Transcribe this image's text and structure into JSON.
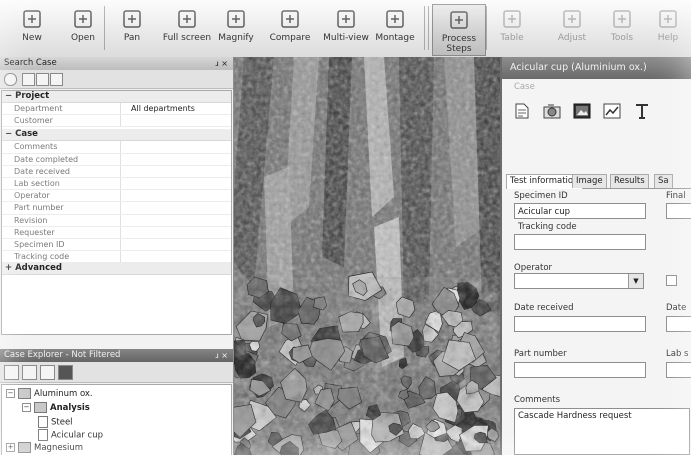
{
  "toolbar": {
    "buttons": [
      {
        "label": "New",
        "icon": "new-document-icon"
      },
      {
        "label": "Open",
        "icon": "open-folder-icon"
      },
      {
        "label": "Pan",
        "icon": "pan-hand-icon"
      },
      {
        "label": "Full screen",
        "icon": "full-screen-icon"
      },
      {
        "label": "Magnify",
        "icon": "magnifier-icon"
      },
      {
        "label": "Compare",
        "icon": "compare-icon"
      },
      {
        "label": "Multi-view",
        "icon": "multi-view-icon"
      },
      {
        "label": "Montage",
        "icon": "montage-icon"
      },
      {
        "label": "Process Steps",
        "icon": "process-steps-icon"
      },
      {
        "label": "Table",
        "icon": "table-icon"
      },
      {
        "label": "Adjust",
        "icon": "adjust-icon"
      },
      {
        "label": "Tools",
        "icon": "tools-icon"
      },
      {
        "label": "Help",
        "icon": "help-icon"
      }
    ]
  },
  "search_case": {
    "title": "Search Case",
    "pin": "ɹ ×",
    "project_section": "Project",
    "project_rows": [
      {
        "key": "Department",
        "value": "All departments"
      },
      {
        "key": "Customer",
        "value": ""
      }
    ],
    "case_section": "Case",
    "case_rows": [
      {
        "key": "Comments",
        "value": ""
      },
      {
        "key": "Date completed",
        "value": ""
      },
      {
        "key": "Date received",
        "value": ""
      },
      {
        "key": "Lab section",
        "value": ""
      },
      {
        "key": "Operator",
        "value": ""
      },
      {
        "key": "Part number",
        "value": ""
      },
      {
        "key": "Revision",
        "value": ""
      },
      {
        "key": "Requester",
        "value": ""
      },
      {
        "key": "Specimen ID",
        "value": ""
      },
      {
        "key": "Tracking code",
        "value": ""
      }
    ],
    "advanced_section": "Advanced"
  },
  "case_explorer": {
    "title": "Case Explorer - Not Filtered",
    "pin": "ɹ ×",
    "tree": [
      {
        "label": "Aluminum ox.",
        "level": 0
      },
      {
        "label": "Analysis",
        "level": 1
      },
      {
        "label": "Steel",
        "level": 2
      },
      {
        "label": "Acicular cup",
        "level": 2
      },
      {
        "label": "Magnesium",
        "level": 0
      }
    ]
  },
  "dialog": {
    "title": "Acicular cup (Aluminium ox.)",
    "menu": "Case",
    "tabs": [
      "Test information",
      "Image",
      "Results",
      "Sa"
    ],
    "fields": {
      "specimen_id_label": "Specimen ID",
      "specimen_id_value": "Acicular cup",
      "tracking_code_label": "Tracking code",
      "tracking_code_value": "",
      "operator_label": "Operator",
      "operator_value": "",
      "date_received_label": "Date received",
      "date_received_value": "",
      "part_number_label": "Part number",
      "part_number_value": "",
      "comments_label": "Comments",
      "comments_value": "Cascade Hardness request",
      "right_label_1": "Final",
      "right_label_2": "Date",
      "right_label_3": "Lab s"
    }
  },
  "colors": {
    "toolbar_bg": "#e6e6e6",
    "panel_title_dark": "#6e6e6e",
    "dialog_title": "#7a7a7a"
  }
}
